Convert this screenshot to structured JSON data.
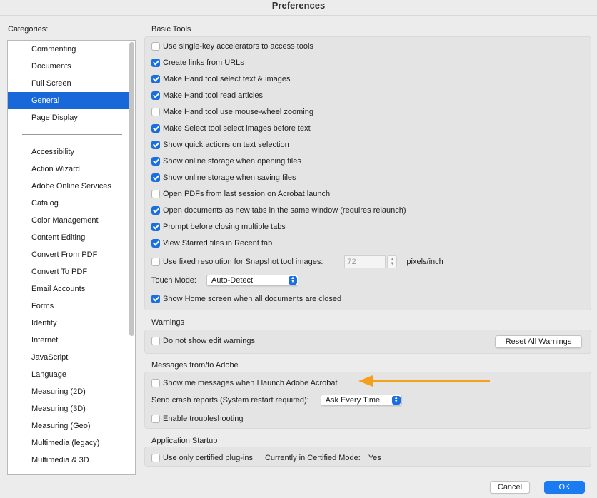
{
  "window": {
    "title": "Preferences"
  },
  "categories": {
    "title": "Categories:",
    "top_items": [
      "Commenting",
      "Documents",
      "Full Screen",
      "General",
      "Page Display"
    ],
    "selected": "General",
    "other_items": [
      "Accessibility",
      "Action Wizard",
      "Adobe Online Services",
      "Catalog",
      "Color Management",
      "Content Editing",
      "Convert From PDF",
      "Convert To PDF",
      "Email Accounts",
      "Forms",
      "Identity",
      "Internet",
      "JavaScript",
      "Language",
      "Measuring (2D)",
      "Measuring (3D)",
      "Measuring (Geo)",
      "Multimedia (legacy)",
      "Multimedia & 3D",
      "Multimedia Trust (legacy)"
    ]
  },
  "basic_tools": {
    "title": "Basic Tools",
    "options": [
      {
        "label": "Use single-key accelerators to access tools",
        "checked": false
      },
      {
        "label": "Create links from URLs",
        "checked": true
      },
      {
        "label": "Make Hand tool select text & images",
        "checked": true
      },
      {
        "label": "Make Hand tool read articles",
        "checked": true
      },
      {
        "label": "Make Hand tool use mouse-wheel zooming",
        "checked": false
      },
      {
        "label": "Make Select tool select images before text",
        "checked": true
      },
      {
        "label": "Show quick actions on text selection",
        "checked": true
      },
      {
        "label": "Show online storage when opening files",
        "checked": true
      },
      {
        "label": "Show online storage when saving files",
        "checked": true
      },
      {
        "label": "Open PDFs from last session on Acrobat launch",
        "checked": false
      },
      {
        "label": "Open documents as new tabs in the same window (requires relaunch)",
        "checked": true
      },
      {
        "label": "Prompt before closing multiple tabs",
        "checked": true
      },
      {
        "label": "View Starred files in Recent tab",
        "checked": true
      }
    ],
    "snapshot": {
      "label": "Use fixed resolution for Snapshot tool images:",
      "checked": false,
      "value": "72",
      "unit": "pixels/inch"
    },
    "touch_mode": {
      "label": "Touch Mode:",
      "value": "Auto-Detect"
    },
    "home_screen": {
      "label": "Show Home screen when all documents are closed",
      "checked": true
    }
  },
  "warnings": {
    "title": "Warnings",
    "no_edit": {
      "label": "Do not show edit warnings",
      "checked": false
    },
    "reset_button": "Reset All Warnings"
  },
  "messages": {
    "title": "Messages from/to Adobe",
    "show_messages": {
      "label": "Show me messages when I launch Adobe Acrobat",
      "checked": false
    },
    "crash_reports": {
      "label": "Send crash reports (System restart required):",
      "value": "Ask Every Time"
    },
    "troubleshooting": {
      "label": "Enable troubleshooting",
      "checked": false
    }
  },
  "startup": {
    "title": "Application Startup",
    "certified": {
      "label": "Use only certified plug-ins",
      "checked": false
    },
    "mode_label": "Currently in Certified Mode:",
    "mode_value": "Yes"
  },
  "footer": {
    "cancel": "Cancel",
    "ok": "OK"
  },
  "colors": {
    "accent": "#1a6fe0",
    "annotation_arrow": "#f5a01a",
    "selection": "#1868d9"
  }
}
